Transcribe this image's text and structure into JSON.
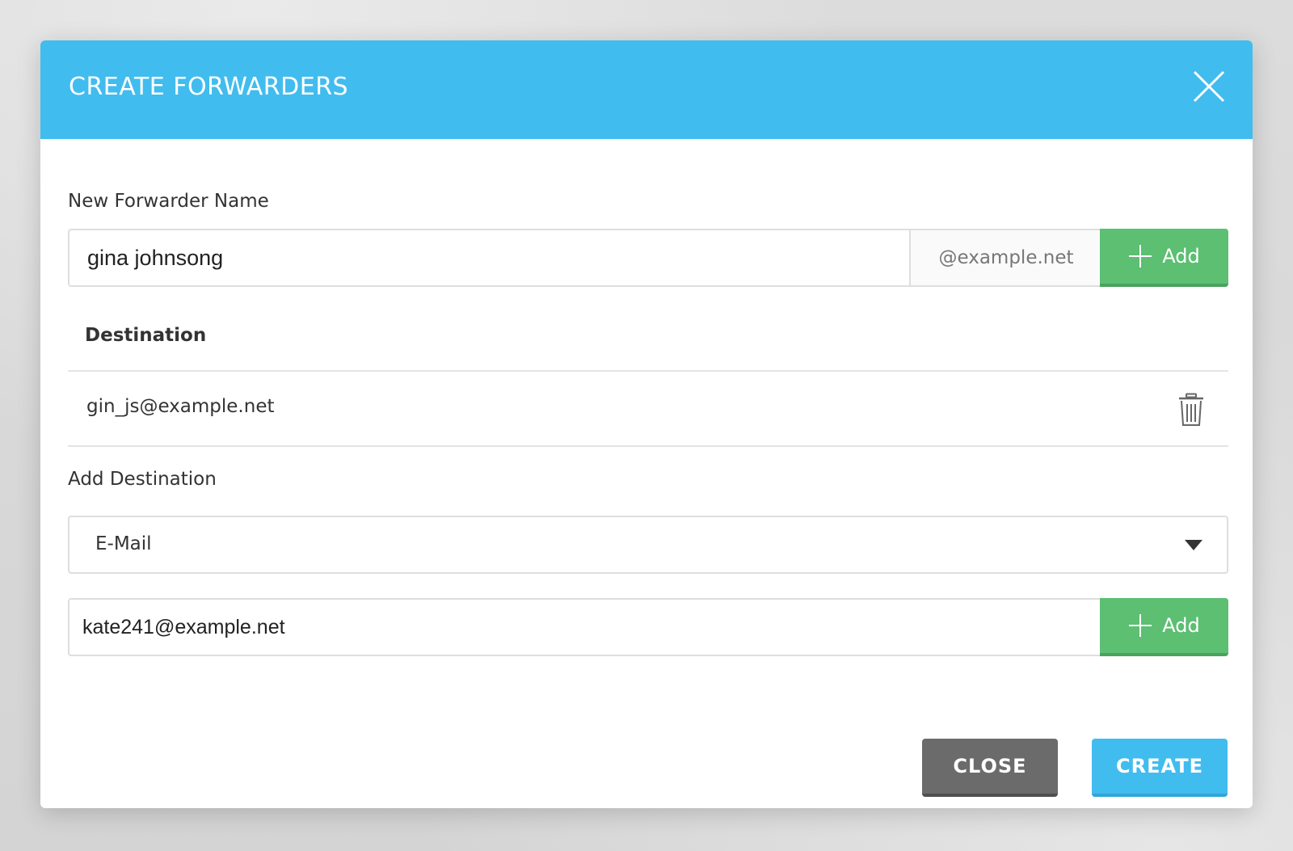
{
  "modal": {
    "title": "CREATE FORWARDERS",
    "close_icon": "close-x-icon"
  },
  "forwarder": {
    "label": "New Forwarder Name",
    "name_value": "gina johnsong",
    "domain_suffix": "@example.net",
    "add_label": "Add"
  },
  "destination": {
    "header": "Destination",
    "items": [
      {
        "address": "gin_js@example.net",
        "icon": "trash-icon"
      }
    ]
  },
  "add_destination": {
    "label": "Add Destination",
    "type_selected": "E-Mail",
    "email_value": "kate241@example.net",
    "add_label": "Add"
  },
  "footer": {
    "close_label": "CLOSE",
    "create_label": "CREATE"
  },
  "colors": {
    "header_blue": "#41bcef",
    "add_green": "#5cbf72",
    "close_gray": "#6b6b6b"
  }
}
